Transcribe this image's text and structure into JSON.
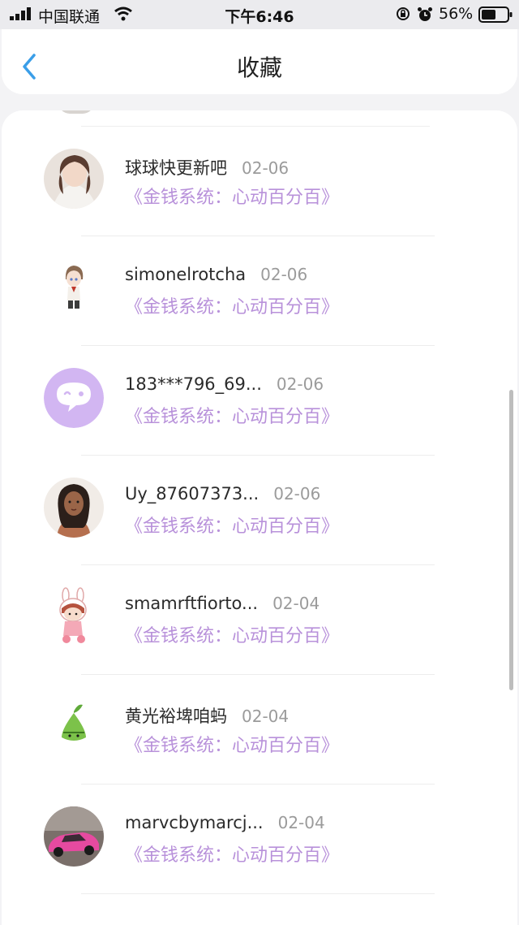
{
  "status_bar": {
    "carrier": "中国联通",
    "time": "下午6:46",
    "battery": "56%"
  },
  "nav": {
    "title": "收藏",
    "icon_back": "chevron-left-icon"
  },
  "colors": {
    "accent": "#3a9ee8",
    "book_title": "#b891da",
    "date": "#9b9b9b"
  },
  "favorites": [
    {
      "user": "球球快更新吧",
      "date": "02-06",
      "book": "《金钱系统：心动百分百》",
      "avatar": "girl-photo-avatar"
    },
    {
      "user": "simonelrotcha",
      "date": "02-06",
      "book": "《金钱系统：心动百分百》",
      "avatar": "anime-boy-avatar"
    },
    {
      "user": "183***796_69...",
      "date": "02-06",
      "book": "《金钱系统：心动百分百》",
      "avatar": "default-chat-avatar"
    },
    {
      "user": "Uy_87607373...",
      "date": "02-06",
      "book": "《金钱系统：心动百分百》",
      "avatar": "woman-illustration-avatar"
    },
    {
      "user": "smamrftfiorto...",
      "date": "02-04",
      "book": "《金钱系统：心动百分百》",
      "avatar": "bunny-girl-avatar"
    },
    {
      "user": "黄光裕埤咱蚂",
      "date": "02-04",
      "book": "《金钱系统：心动百分百》",
      "avatar": "zongzi-avatar"
    },
    {
      "user": "marvcbymarcj...",
      "date": "02-04",
      "book": "《金钱系统：心动百分百》",
      "avatar": "pink-car-avatar"
    }
  ]
}
